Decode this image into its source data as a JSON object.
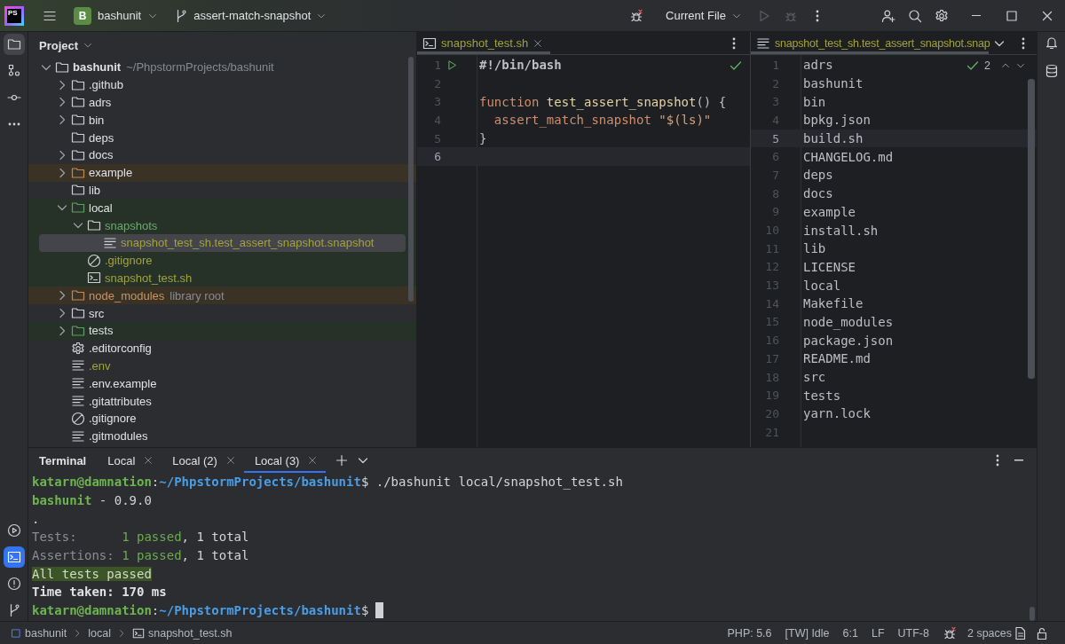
{
  "title_bar": {
    "logo": "PS",
    "project": {
      "initial": "B",
      "name": "bashunit"
    },
    "branch": "assert-match-snapshot",
    "run_configuration": "Current File",
    "actions": [
      {
        "kind": "run",
        "disabled": true
      },
      {
        "kind": "debug",
        "disabled": true
      }
    ]
  },
  "tool_strip": {
    "top": [
      {
        "selected": true
      },
      {
        "selected": false
      },
      {
        "selected": false
      },
      {
        "selected": false
      }
    ],
    "bottom": [
      {
        "selected": false
      },
      {
        "selected": true
      },
      {
        "selected": false
      },
      {
        "selected": false
      }
    ]
  },
  "project": {
    "title": "Project",
    "tree": [
      {
        "label": "bashunit",
        "hint": "~/PhpstormProjects/bashunit",
        "kind": "folder",
        "expanded": true,
        "selected": false,
        "children": [
          {
            "label": ".github",
            "kind": "folder",
            "expanded": false,
            "selected": false
          },
          {
            "label": "adrs",
            "kind": "folder",
            "expanded": false,
            "selected": false
          },
          {
            "label": "bin",
            "kind": "folder",
            "expanded": false,
            "selected": false
          },
          {
            "label": "deps",
            "kind": "folder",
            "selected": false
          },
          {
            "label": "docs",
            "kind": "folder",
            "expanded": false,
            "selected": false
          },
          {
            "label": "example",
            "kind": "folder",
            "expanded": false,
            "selected": false,
            "icon": {
              "color": "#c48a55"
            },
            "highlight": {
              "color": "#3b3226"
            }
          },
          {
            "label": "lib",
            "kind": "folder",
            "selected": false
          },
          {
            "label": "local",
            "kind": "folder",
            "expanded": true,
            "selected": false,
            "icon": {
              "color": "#5f9e66"
            },
            "highlight": {
              "color": "#263228"
            },
            "children": [
              {
                "label": "snapshots",
                "kind": "folder",
                "expanded": true,
                "selected": false,
                "color": "#6aa96a",
                "highlight": {
                  "color": "#263228"
                },
                "children": [
                  {
                    "label": "snapshot_test_sh.test_assert_snapshot.snapshot",
                    "kind": "file-text",
                    "selected": true,
                    "color": "#a3a33b",
                    "highlight": {
                      "color": "#263228"
                    }
                  }
                ]
              },
              {
                "label": ".gitignore",
                "kind": "file-ignore",
                "selected": false,
                "color": "#a3a33b",
                "highlight": {
                  "color": "#263228"
                }
              },
              {
                "label": "snapshot_test.sh",
                "kind": "file-shell",
                "selected": false,
                "color": "#a3a33b",
                "highlight": {
                  "color": "#263228"
                }
              }
            ]
          },
          {
            "label": "node_modules",
            "hint": "library root",
            "kind": "folder",
            "expanded": false,
            "selected": false,
            "color": "#c8955f",
            "icon": {
              "color": "#c48a55"
            },
            "highlight": {
              "color": "#3b3226"
            }
          },
          {
            "label": "src",
            "kind": "folder",
            "expanded": false,
            "selected": false
          },
          {
            "label": "tests",
            "kind": "folder",
            "expanded": false,
            "selected": false,
            "icon": {
              "color": "#5f9e66"
            },
            "highlight": {
              "color": "#263228"
            }
          },
          {
            "label": ".editorconfig",
            "kind": "file-config",
            "selected": false
          },
          {
            "label": ".env",
            "kind": "file-text",
            "selected": false,
            "color": "#a3a33b"
          },
          {
            "label": ".env.example",
            "kind": "file-text",
            "selected": false
          },
          {
            "label": ".gitattributes",
            "kind": "file-text",
            "selected": false
          },
          {
            "label": ".gitignore",
            "kind": "file-ignore",
            "selected": false
          },
          {
            "label": ".gitmodules",
            "kind": "file-text",
            "selected": false
          }
        ]
      }
    ]
  },
  "editors": [
    {
      "tab": {
        "label": "snapshot_test.sh",
        "kind": "file-shell",
        "color": "#a3a33b",
        "selected": true
      },
      "tab_overflow": false,
      "inspection": {
        "ok": true
      },
      "lines": [
        {
          "number": "1",
          "current": false,
          "run": true,
          "tokens": [
            {
              "text": "#!/bin/bash",
              "kind": "shebang"
            }
          ]
        },
        {
          "number": "2",
          "current": false,
          "run": false
        },
        {
          "number": "3",
          "current": false,
          "run": false,
          "tokens": [
            {
              "text": "function ",
              "kind": "keyword"
            },
            {
              "text": "test_assert_snapshot",
              "kind": "function"
            },
            {
              "text": "() {",
              "kind": "plain"
            }
          ]
        },
        {
          "number": "4",
          "current": false,
          "run": false,
          "tokens": [
            {
              "text": "  assert_match_snapshot ",
              "kind": "command"
            },
            {
              "text": "\"$(ls)\"",
              "kind": "string"
            }
          ]
        },
        {
          "number": "5",
          "current": false,
          "run": false,
          "tokens": [
            {
              "text": "}",
              "kind": "plain"
            }
          ]
        },
        {
          "number": "6",
          "current": true,
          "run": false
        }
      ]
    },
    {
      "tab": {
        "label": "snapshot_test_sh.test_assert_snapshot.snap",
        "kind": "file-text",
        "color": "#a3a33b",
        "selected": true
      },
      "tab_overflow": true,
      "inspection": {
        "ok": true,
        "count": "2"
      },
      "lines": [
        {
          "number": "1",
          "current": false,
          "text": "adrs"
        },
        {
          "number": "2",
          "current": false,
          "text": "bashunit"
        },
        {
          "number": "3",
          "current": false,
          "text": "bin"
        },
        {
          "number": "4",
          "current": false,
          "text": "bpkg.json"
        },
        {
          "number": "5",
          "current": true,
          "text": "build.sh"
        },
        {
          "number": "6",
          "current": false,
          "text": "CHANGELOG.md"
        },
        {
          "number": "7",
          "current": false,
          "text": "deps"
        },
        {
          "number": "8",
          "current": false,
          "text": "docs"
        },
        {
          "number": "9",
          "current": false,
          "text": "example"
        },
        {
          "number": "10",
          "current": false,
          "text": "install.sh"
        },
        {
          "number": "11",
          "current": false,
          "text": "lib"
        },
        {
          "number": "12",
          "current": false,
          "text": "LICENSE"
        },
        {
          "number": "13",
          "current": false,
          "text": "local"
        },
        {
          "number": "14",
          "current": false,
          "text": "Makefile"
        },
        {
          "number": "15",
          "current": false,
          "text": "node_modules"
        },
        {
          "number": "16",
          "current": false,
          "text": "package.json"
        },
        {
          "number": "17",
          "current": false,
          "text": "README.md"
        },
        {
          "number": "18",
          "current": false,
          "text": "src"
        },
        {
          "number": "19",
          "current": false,
          "text": "tests"
        },
        {
          "number": "20",
          "current": false,
          "text": "yarn.lock"
        },
        {
          "number": "21",
          "current": false
        }
      ]
    }
  ],
  "terminal": {
    "title": "Terminal",
    "tabs": [
      {
        "label": "Local",
        "selected": false
      },
      {
        "label": "Local (2)",
        "selected": false
      },
      {
        "label": "Local (3)",
        "selected": true
      }
    ],
    "lines": [
      {
        "cursor": false,
        "spans": [
          {
            "text": "katarn@damnation",
            "kind": "user"
          },
          {
            "text": ":",
            "kind": "plain"
          },
          {
            "text": "~/PhpstormProjects/bashunit",
            "kind": "path"
          },
          {
            "text": "$ ./bashunit local/snapshot_test.sh",
            "kind": "plain"
          }
        ]
      },
      {
        "cursor": false,
        "spans": [
          {
            "text": "bashunit",
            "kind": "user"
          },
          {
            "text": " - 0.9.0",
            "kind": "plain"
          }
        ]
      },
      {
        "cursor": false,
        "spans": [
          {
            "text": ".",
            "kind": "plain"
          }
        ]
      },
      {
        "cursor": false,
        "spans": [
          {
            "text": "Tests:      ",
            "kind": "dim"
          },
          {
            "text": "1 passed",
            "kind": "pass"
          },
          {
            "text": ", 1 total",
            "kind": "plain"
          }
        ]
      },
      {
        "cursor": false,
        "spans": [
          {
            "text": "Assertions: ",
            "kind": "dim"
          },
          {
            "text": "1 passed",
            "kind": "pass"
          },
          {
            "text": ", 1 total",
            "kind": "plain"
          }
        ]
      },
      {
        "cursor": false,
        "spans": [
          {
            "text": "All tests passed",
            "kind": "success"
          }
        ]
      },
      {
        "cursor": false,
        "spans": [
          {
            "text": "Time taken: 170 ms",
            "kind": "bold"
          }
        ]
      },
      {
        "cursor": true,
        "spans": [
          {
            "text": "katarn@damnation",
            "kind": "user"
          },
          {
            "text": ":",
            "kind": "plain"
          },
          {
            "text": "~/PhpstormProjects/bashunit",
            "kind": "path"
          },
          {
            "text": "$",
            "kind": "plain"
          }
        ]
      }
    ]
  },
  "status_bar": {
    "breadcrumbs": [
      {
        "label": "bashunit",
        "kind": "project"
      },
      {
        "label": "local",
        "kind": "folder"
      },
      {
        "label": "snapshot_test.sh",
        "kind": "file-shell"
      }
    ],
    "widgets": [
      "PHP: 5.6",
      "[TW] Idle",
      "6:1",
      "LF",
      "UTF-8"
    ],
    "indent": "2 spaces"
  }
}
